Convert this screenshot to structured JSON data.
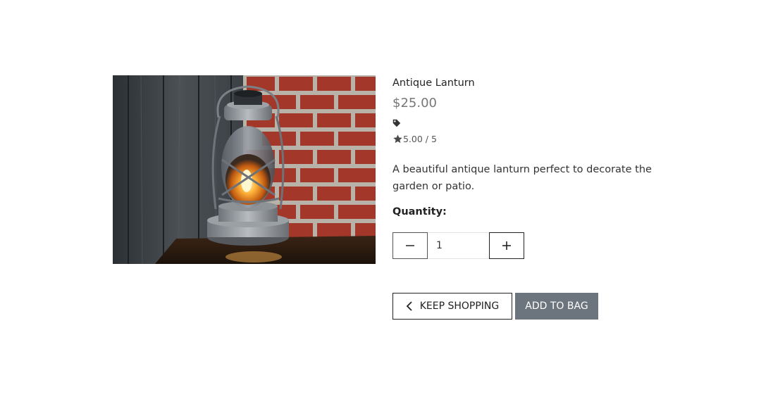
{
  "product": {
    "name": "Antique Lanturn",
    "price": "$25.00",
    "tag_icon": "tag-icon",
    "rating_icon": "star-icon",
    "rating": "5.00 / 5",
    "description": "A beautiful antique lanturn perfect to decorate the garden or patio.",
    "image": "lantern-photo"
  },
  "quantity": {
    "label": "Quantity:",
    "value": "1",
    "decrement_icon": "minus-icon",
    "increment_icon": "plus-icon"
  },
  "actions": {
    "keep_shopping_icon": "chevron-left-icon",
    "keep_shopping_label": "KEEP SHOPPING",
    "add_to_bag_label": "ADD TO BAG"
  },
  "colors": {
    "add_to_bag_bg": "#6c757d",
    "price_text": "#777777",
    "border_dark": "#222222"
  }
}
